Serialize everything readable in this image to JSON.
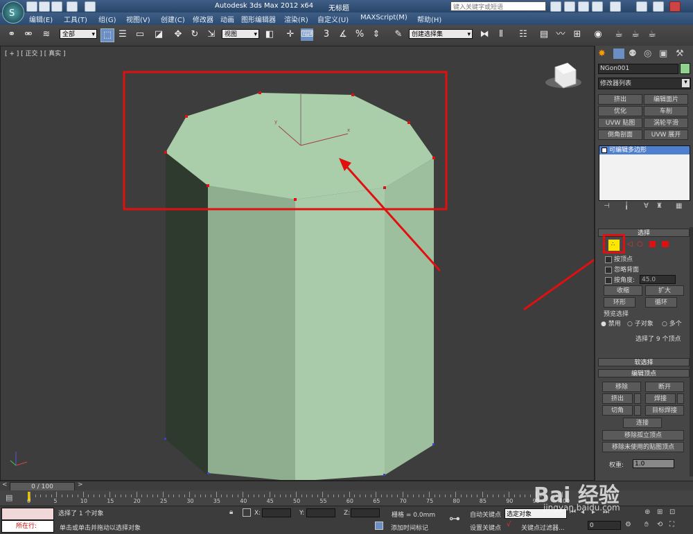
{
  "title_bar": {
    "app_title": "Autodesk 3ds Max  2012 x64",
    "document_title": "无标题",
    "search_placeholder": "键入关键字或短语"
  },
  "menu": {
    "items": [
      "编辑(E)",
      "工具(T)",
      "组(G)",
      "视图(V)",
      "创建(C)",
      "修改器",
      "动画",
      "图形编辑器",
      "渲染(R)",
      "自定义(U)",
      "MAXScript(M)",
      "帮助(H)"
    ]
  },
  "toolbar": {
    "selection_filter": "全部",
    "reference_coord": "视图",
    "named_selection_placeholder": "创建选择集",
    "snap_label": "3"
  },
  "viewport": {
    "label": "[ + ] [ 正交 ] [ 真实 ]",
    "object_color": "#a9cba9"
  },
  "command_panel": {
    "object_name": "NGon001",
    "object_color": "#8fd38f",
    "modifier_list": "修改器列表",
    "modifier_buttons": [
      "挤出",
      "编辑面片",
      "优化",
      "车削",
      "UVW 贴图",
      "涡轮平滑",
      "倒角剖面",
      "UVW 展开"
    ],
    "stack_item": "可编辑多边形",
    "selection_rollout": {
      "title": "选择",
      "by_vertex": "按顶点",
      "ignore_backfacing": "忽略背面",
      "by_angle": "按角度:",
      "angle_value": "45.0",
      "shrink": "收缩",
      "grow": "扩大",
      "ring": "环形",
      "loop": "循环",
      "preview_title": "预览选择",
      "preview_options": [
        "禁用",
        "子对象",
        "多个"
      ],
      "status": "选择了 9 个顶点"
    },
    "soft_selection": "软选择",
    "edit_vertices": {
      "title": "编辑顶点",
      "remove": "移除",
      "break": "断开",
      "extrude": "挤出",
      "weld": "焊接",
      "chamfer": "切角",
      "target_weld": "目标焊接",
      "connect": "连接",
      "remove_isolated": "移除孤立顶点",
      "remove_unused": "移除未使用的贴图顶点",
      "weight_label": "权重:",
      "weight_value": "1.0"
    }
  },
  "timeline": {
    "frame_display": "0 / 100",
    "ticks": [
      "0",
      "5",
      "10",
      "15",
      "20",
      "25",
      "30",
      "35",
      "40",
      "45",
      "50",
      "55",
      "60",
      "65",
      "70",
      "75",
      "80",
      "85",
      "90",
      "95",
      "100"
    ]
  },
  "status_bar": {
    "selection_info": "选择了 1 个对象",
    "prompt": "单击或单击并拖动以选择对象",
    "running": "所在行:",
    "x_label": "X:",
    "y_label": "Y:",
    "z_label": "Z:",
    "grid": "栅格 = 0.0mm",
    "add_time_tag": "添加时间标记",
    "auto_key": "自动关键点",
    "set_key": "设置关键点",
    "selected": "选定对象",
    "key_filters": "关键点过滤器...",
    "frame": "0"
  },
  "watermark": {
    "brand": "Bai  经验",
    "url": "jingyan.baidu.com"
  }
}
